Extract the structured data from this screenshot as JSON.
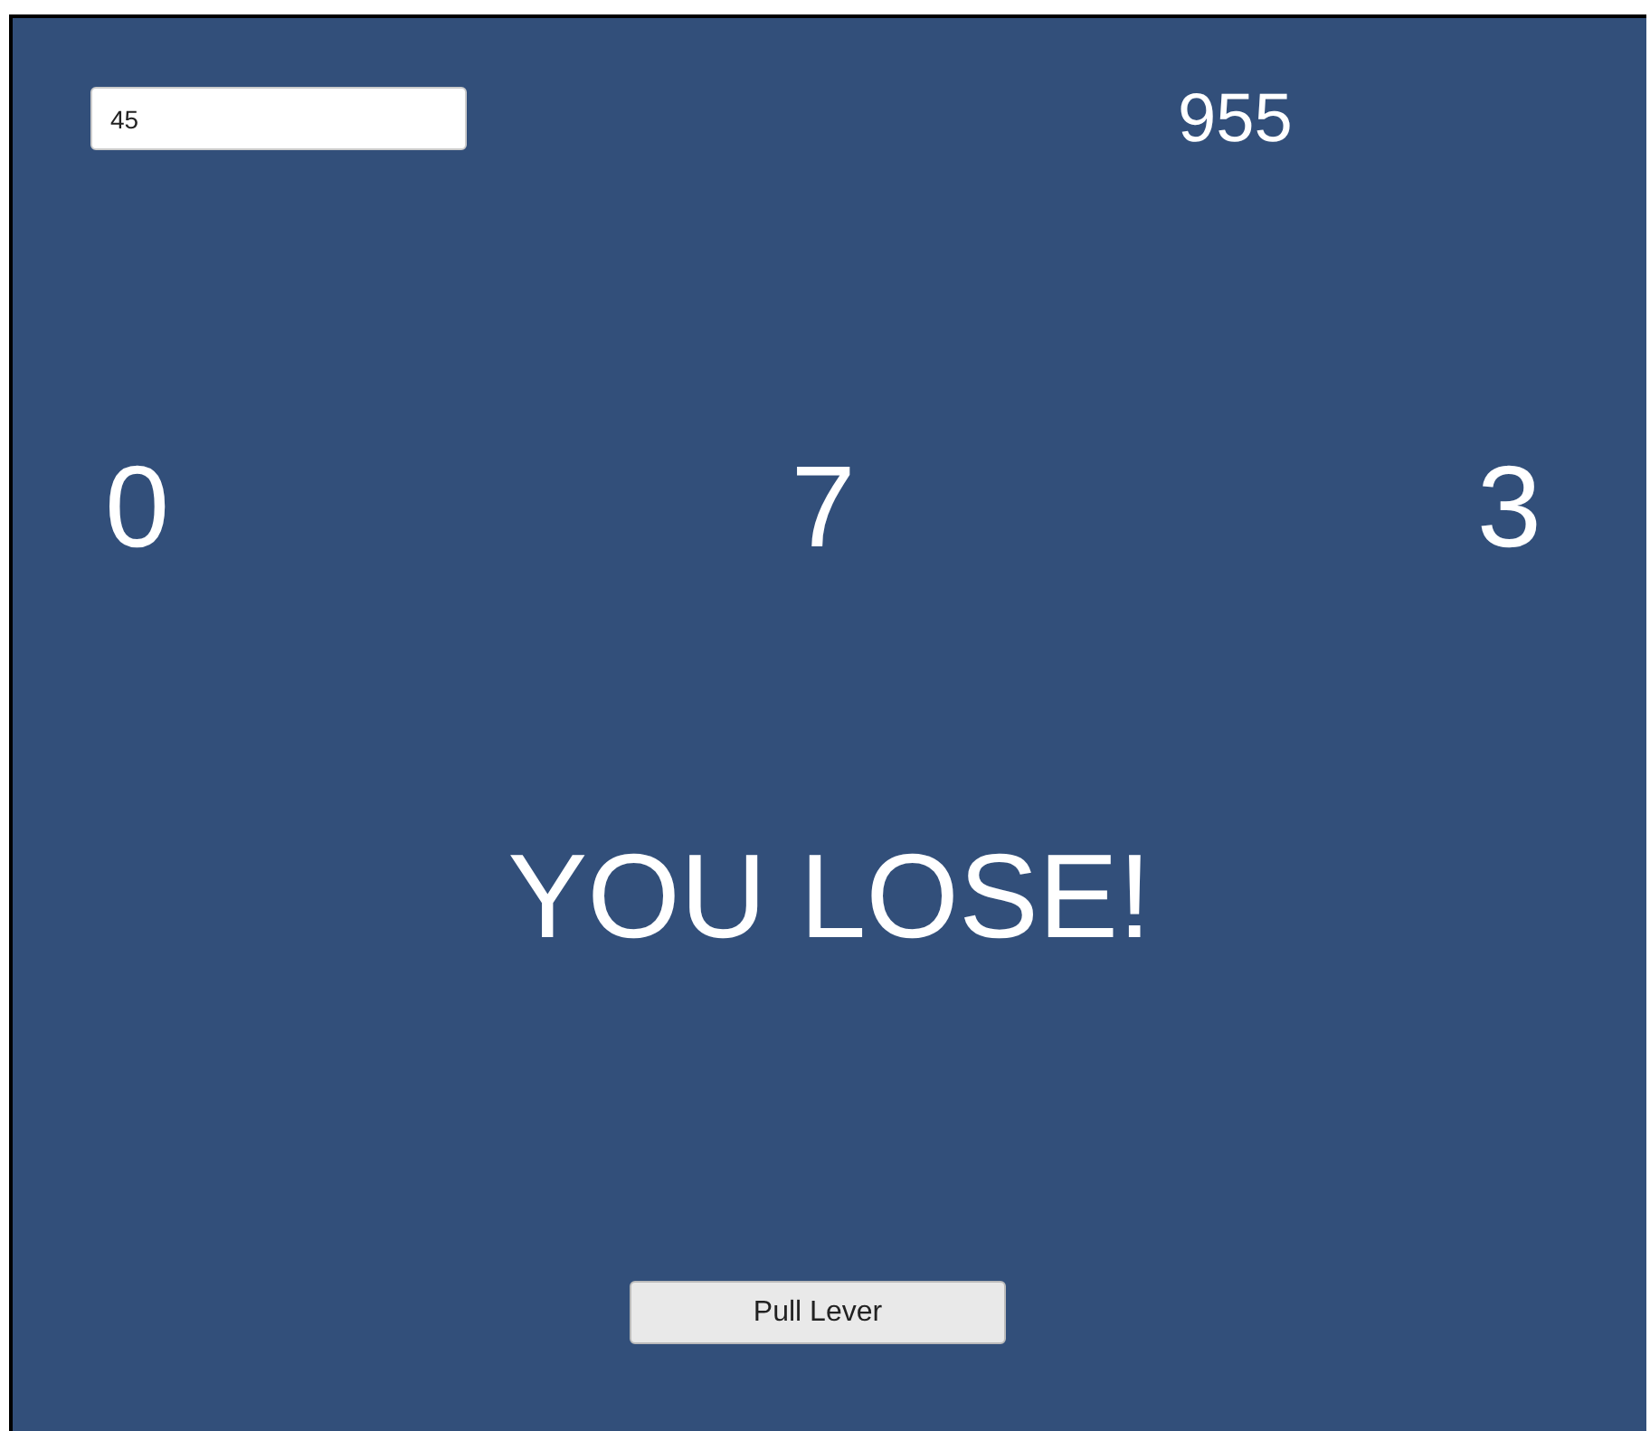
{
  "bet_field": {
    "value": "45"
  },
  "score": "955",
  "reels": [
    "0",
    "7",
    "3"
  ],
  "message": "YOU LOSE!",
  "button": "Pull Lever"
}
